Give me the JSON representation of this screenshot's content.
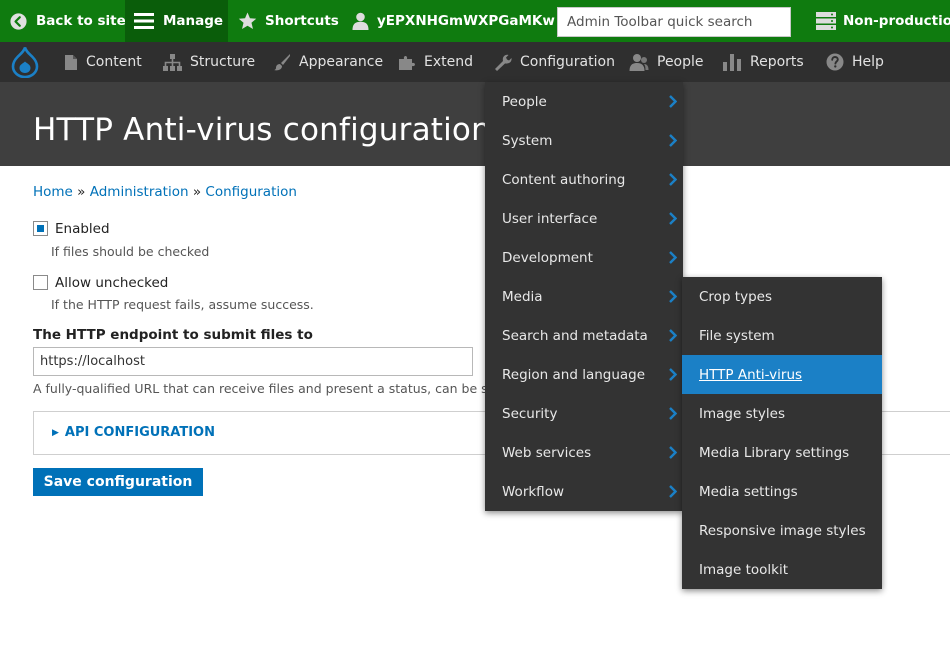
{
  "toolbar": {
    "back_label": "Back to site",
    "manage_label": "Manage",
    "shortcuts_label": "Shortcuts",
    "user_label": "yEPXNHGmWXPGaMKw",
    "search_placeholder": "Admin Toolbar quick search",
    "env_label": "Non-production",
    "background_color": "#0f7b0f"
  },
  "admin_menu": {
    "items": [
      {
        "label": "Content",
        "icon": "document-icon"
      },
      {
        "label": "Structure",
        "icon": "sitemap-icon"
      },
      {
        "label": "Appearance",
        "icon": "paintbrush-icon"
      },
      {
        "label": "Extend",
        "icon": "puzzle-icon"
      },
      {
        "label": "Configuration",
        "icon": "wrench-icon"
      },
      {
        "label": "People",
        "icon": "people-icon"
      },
      {
        "label": "Reports",
        "icon": "bar-chart-icon"
      },
      {
        "label": "Help",
        "icon": "help-icon"
      }
    ]
  },
  "page": {
    "title": "HTTP Anti-virus configuration"
  },
  "breadcrumb": {
    "home": "Home",
    "sep1": "»",
    "administration": "Administration",
    "sep2": "»",
    "configuration": "Configuration"
  },
  "form": {
    "enabled": {
      "label": "Enabled",
      "checked": true,
      "description": "If files should be checked"
    },
    "allow_unchecked": {
      "label": "Allow unchecked",
      "checked": false,
      "description": "If the HTTP request fails, assume success."
    },
    "endpoint": {
      "label": "The HTTP endpoint to submit files to",
      "value": "https://localhost",
      "description": "A fully-qualified URL that can receive files and present a status, can be set with"
    },
    "api_section": "API CONFIGURATION",
    "save_label": "Save configuration",
    "accent_color": "#0071b8"
  },
  "configuration_menu": {
    "items": [
      {
        "label": "People"
      },
      {
        "label": "System"
      },
      {
        "label": "Content authoring"
      },
      {
        "label": "User interface"
      },
      {
        "label": "Development"
      },
      {
        "label": "Media"
      },
      {
        "label": "Search and metadata"
      },
      {
        "label": "Region and language"
      },
      {
        "label": "Security"
      },
      {
        "label": "Web services"
      },
      {
        "label": "Workflow"
      }
    ]
  },
  "media_submenu": {
    "items": [
      {
        "label": "Crop types"
      },
      {
        "label": "File system"
      },
      {
        "label": "HTTP Anti-virus",
        "active": true
      },
      {
        "label": "Image styles"
      },
      {
        "label": "Media Library settings"
      },
      {
        "label": "Media settings"
      },
      {
        "label": "Responsive image styles"
      },
      {
        "label": "Image toolkit"
      }
    ],
    "active_color": "#1b80c6"
  }
}
